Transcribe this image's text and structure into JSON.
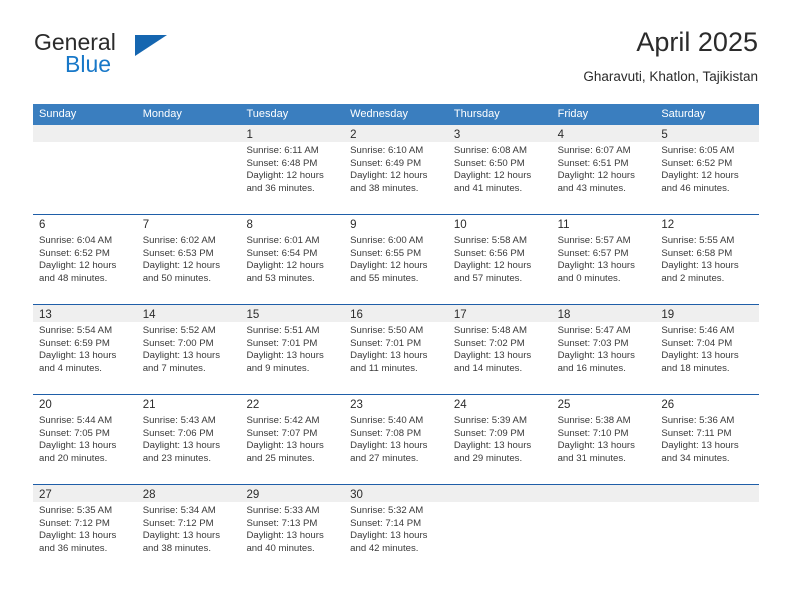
{
  "brand": {
    "line1": "General",
    "line2": "Blue",
    "triangle_icon": "triangle-icon"
  },
  "header": {
    "title": "April 2025",
    "location": "Gharavuti, Khatlon, Tajikistan"
  },
  "colors": {
    "header_blue": "#3a7ebf",
    "row_divider_blue": "#1f5ea8",
    "brand_blue": "#1878c8",
    "alt_row_gray": "#efefef"
  },
  "calendar": {
    "weekdays": [
      "Sunday",
      "Monday",
      "Tuesday",
      "Wednesday",
      "Thursday",
      "Friday",
      "Saturday"
    ],
    "weeks": [
      [
        {
          "day": "",
          "sunrise": "",
          "sunset": "",
          "daylight1": "",
          "daylight2": ""
        },
        {
          "day": "",
          "sunrise": "",
          "sunset": "",
          "daylight1": "",
          "daylight2": ""
        },
        {
          "day": "1",
          "sunrise": "Sunrise: 6:11 AM",
          "sunset": "Sunset: 6:48 PM",
          "daylight1": "Daylight: 12 hours",
          "daylight2": "and 36 minutes."
        },
        {
          "day": "2",
          "sunrise": "Sunrise: 6:10 AM",
          "sunset": "Sunset: 6:49 PM",
          "daylight1": "Daylight: 12 hours",
          "daylight2": "and 38 minutes."
        },
        {
          "day": "3",
          "sunrise": "Sunrise: 6:08 AM",
          "sunset": "Sunset: 6:50 PM",
          "daylight1": "Daylight: 12 hours",
          "daylight2": "and 41 minutes."
        },
        {
          "day": "4",
          "sunrise": "Sunrise: 6:07 AM",
          "sunset": "Sunset: 6:51 PM",
          "daylight1": "Daylight: 12 hours",
          "daylight2": "and 43 minutes."
        },
        {
          "day": "5",
          "sunrise": "Sunrise: 6:05 AM",
          "sunset": "Sunset: 6:52 PM",
          "daylight1": "Daylight: 12 hours",
          "daylight2": "and 46 minutes."
        }
      ],
      [
        {
          "day": "6",
          "sunrise": "Sunrise: 6:04 AM",
          "sunset": "Sunset: 6:52 PM",
          "daylight1": "Daylight: 12 hours",
          "daylight2": "and 48 minutes."
        },
        {
          "day": "7",
          "sunrise": "Sunrise: 6:02 AM",
          "sunset": "Sunset: 6:53 PM",
          "daylight1": "Daylight: 12 hours",
          "daylight2": "and 50 minutes."
        },
        {
          "day": "8",
          "sunrise": "Sunrise: 6:01 AM",
          "sunset": "Sunset: 6:54 PM",
          "daylight1": "Daylight: 12 hours",
          "daylight2": "and 53 minutes."
        },
        {
          "day": "9",
          "sunrise": "Sunrise: 6:00 AM",
          "sunset": "Sunset: 6:55 PM",
          "daylight1": "Daylight: 12 hours",
          "daylight2": "and 55 minutes."
        },
        {
          "day": "10",
          "sunrise": "Sunrise: 5:58 AM",
          "sunset": "Sunset: 6:56 PM",
          "daylight1": "Daylight: 12 hours",
          "daylight2": "and 57 minutes."
        },
        {
          "day": "11",
          "sunrise": "Sunrise: 5:57 AM",
          "sunset": "Sunset: 6:57 PM",
          "daylight1": "Daylight: 13 hours",
          "daylight2": "and 0 minutes."
        },
        {
          "day": "12",
          "sunrise": "Sunrise: 5:55 AM",
          "sunset": "Sunset: 6:58 PM",
          "daylight1": "Daylight: 13 hours",
          "daylight2": "and 2 minutes."
        }
      ],
      [
        {
          "day": "13",
          "sunrise": "Sunrise: 5:54 AM",
          "sunset": "Sunset: 6:59 PM",
          "daylight1": "Daylight: 13 hours",
          "daylight2": "and 4 minutes."
        },
        {
          "day": "14",
          "sunrise": "Sunrise: 5:52 AM",
          "sunset": "Sunset: 7:00 PM",
          "daylight1": "Daylight: 13 hours",
          "daylight2": "and 7 minutes."
        },
        {
          "day": "15",
          "sunrise": "Sunrise: 5:51 AM",
          "sunset": "Sunset: 7:01 PM",
          "daylight1": "Daylight: 13 hours",
          "daylight2": "and 9 minutes."
        },
        {
          "day": "16",
          "sunrise": "Sunrise: 5:50 AM",
          "sunset": "Sunset: 7:01 PM",
          "daylight1": "Daylight: 13 hours",
          "daylight2": "and 11 minutes."
        },
        {
          "day": "17",
          "sunrise": "Sunrise: 5:48 AM",
          "sunset": "Sunset: 7:02 PM",
          "daylight1": "Daylight: 13 hours",
          "daylight2": "and 14 minutes."
        },
        {
          "day": "18",
          "sunrise": "Sunrise: 5:47 AM",
          "sunset": "Sunset: 7:03 PM",
          "daylight1": "Daylight: 13 hours",
          "daylight2": "and 16 minutes."
        },
        {
          "day": "19",
          "sunrise": "Sunrise: 5:46 AM",
          "sunset": "Sunset: 7:04 PM",
          "daylight1": "Daylight: 13 hours",
          "daylight2": "and 18 minutes."
        }
      ],
      [
        {
          "day": "20",
          "sunrise": "Sunrise: 5:44 AM",
          "sunset": "Sunset: 7:05 PM",
          "daylight1": "Daylight: 13 hours",
          "daylight2": "and 20 minutes."
        },
        {
          "day": "21",
          "sunrise": "Sunrise: 5:43 AM",
          "sunset": "Sunset: 7:06 PM",
          "daylight1": "Daylight: 13 hours",
          "daylight2": "and 23 minutes."
        },
        {
          "day": "22",
          "sunrise": "Sunrise: 5:42 AM",
          "sunset": "Sunset: 7:07 PM",
          "daylight1": "Daylight: 13 hours",
          "daylight2": "and 25 minutes."
        },
        {
          "day": "23",
          "sunrise": "Sunrise: 5:40 AM",
          "sunset": "Sunset: 7:08 PM",
          "daylight1": "Daylight: 13 hours",
          "daylight2": "and 27 minutes."
        },
        {
          "day": "24",
          "sunrise": "Sunrise: 5:39 AM",
          "sunset": "Sunset: 7:09 PM",
          "daylight1": "Daylight: 13 hours",
          "daylight2": "and 29 minutes."
        },
        {
          "day": "25",
          "sunrise": "Sunrise: 5:38 AM",
          "sunset": "Sunset: 7:10 PM",
          "daylight1": "Daylight: 13 hours",
          "daylight2": "and 31 minutes."
        },
        {
          "day": "26",
          "sunrise": "Sunrise: 5:36 AM",
          "sunset": "Sunset: 7:11 PM",
          "daylight1": "Daylight: 13 hours",
          "daylight2": "and 34 minutes."
        }
      ],
      [
        {
          "day": "27",
          "sunrise": "Sunrise: 5:35 AM",
          "sunset": "Sunset: 7:12 PM",
          "daylight1": "Daylight: 13 hours",
          "daylight2": "and 36 minutes."
        },
        {
          "day": "28",
          "sunrise": "Sunrise: 5:34 AM",
          "sunset": "Sunset: 7:12 PM",
          "daylight1": "Daylight: 13 hours",
          "daylight2": "and 38 minutes."
        },
        {
          "day": "29",
          "sunrise": "Sunrise: 5:33 AM",
          "sunset": "Sunset: 7:13 PM",
          "daylight1": "Daylight: 13 hours",
          "daylight2": "and 40 minutes."
        },
        {
          "day": "30",
          "sunrise": "Sunrise: 5:32 AM",
          "sunset": "Sunset: 7:14 PM",
          "daylight1": "Daylight: 13 hours",
          "daylight2": "and 42 minutes."
        },
        {
          "day": "",
          "sunrise": "",
          "sunset": "",
          "daylight1": "",
          "daylight2": ""
        },
        {
          "day": "",
          "sunrise": "",
          "sunset": "",
          "daylight1": "",
          "daylight2": ""
        },
        {
          "day": "",
          "sunrise": "",
          "sunset": "",
          "daylight1": "",
          "daylight2": ""
        }
      ]
    ]
  }
}
